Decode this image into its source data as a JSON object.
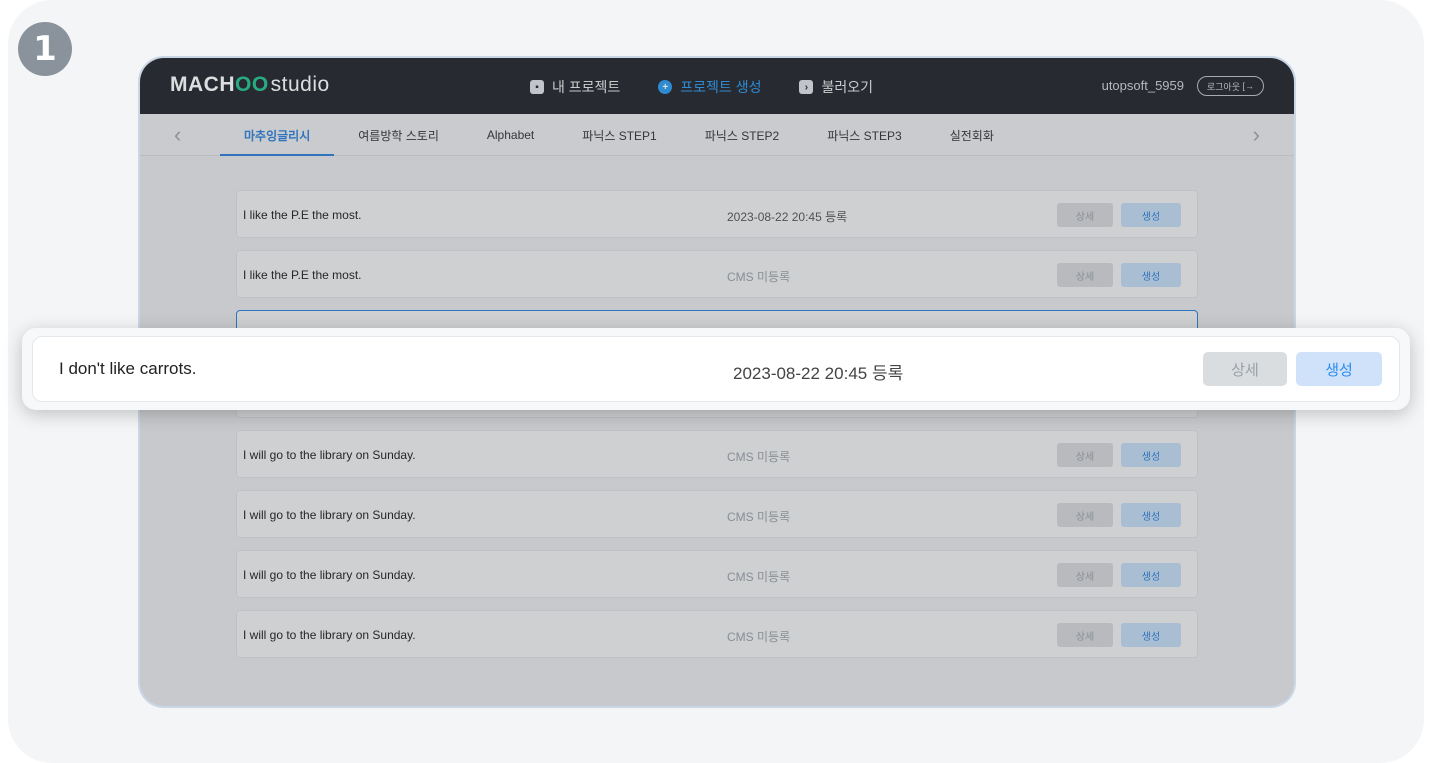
{
  "step_number": "1",
  "app": {
    "logo_prefix": "MACH",
    "logo_oo": "OO",
    "logo_suffix": "studio",
    "nav": [
      {
        "label": "내 프로젝트",
        "icon": "folder-icon",
        "active": false
      },
      {
        "label": "프로젝트 생성",
        "icon": "plus-circle-icon",
        "active": true
      },
      {
        "label": "불러오기",
        "icon": "import-icon",
        "active": false
      }
    ],
    "user_name": "utopsoft_5959",
    "logout_label": "로그아웃"
  },
  "tabs": [
    {
      "label": "마추잉글리시",
      "active": true
    },
    {
      "label": "여름방학 스토리",
      "active": false
    },
    {
      "label": "Alphabet",
      "active": false
    },
    {
      "label": "파닉스 STEP1",
      "active": false
    },
    {
      "label": "파닉스 STEP2",
      "active": false
    },
    {
      "label": "파닉스 STEP3",
      "active": false
    },
    {
      "label": "실전회화",
      "active": false
    }
  ],
  "list": {
    "rows": [
      {
        "title": "I like the P.E the most.",
        "status": "2023-08-22  20:45 등록"
      },
      {
        "title": "I like the P.E the most.",
        "status": "CMS 미등록"
      },
      {
        "title": "",
        "status": ""
      },
      {
        "title": "",
        "status": ""
      },
      {
        "title": "I will go to the library on Sunday.",
        "status": "CMS 미등록"
      },
      {
        "title": "I will go to the library on Sunday.",
        "status": "CMS 미등록"
      },
      {
        "title": "I will go to the library on Sunday.",
        "status": "CMS 미등록"
      },
      {
        "title": "I will go to the library on Sunday.",
        "status": "CMS 미등록"
      }
    ],
    "detail_label": "상세",
    "create_label": "생성"
  },
  "zoom": {
    "title": "I  don't like carrots.",
    "status": "2023-08-22  20:45 등록",
    "detail_label": "상세",
    "create_label": "생성"
  },
  "colors": {
    "accent": "#2d7fd6",
    "logo_green": "#25c28e",
    "topbar": "#23262c"
  }
}
